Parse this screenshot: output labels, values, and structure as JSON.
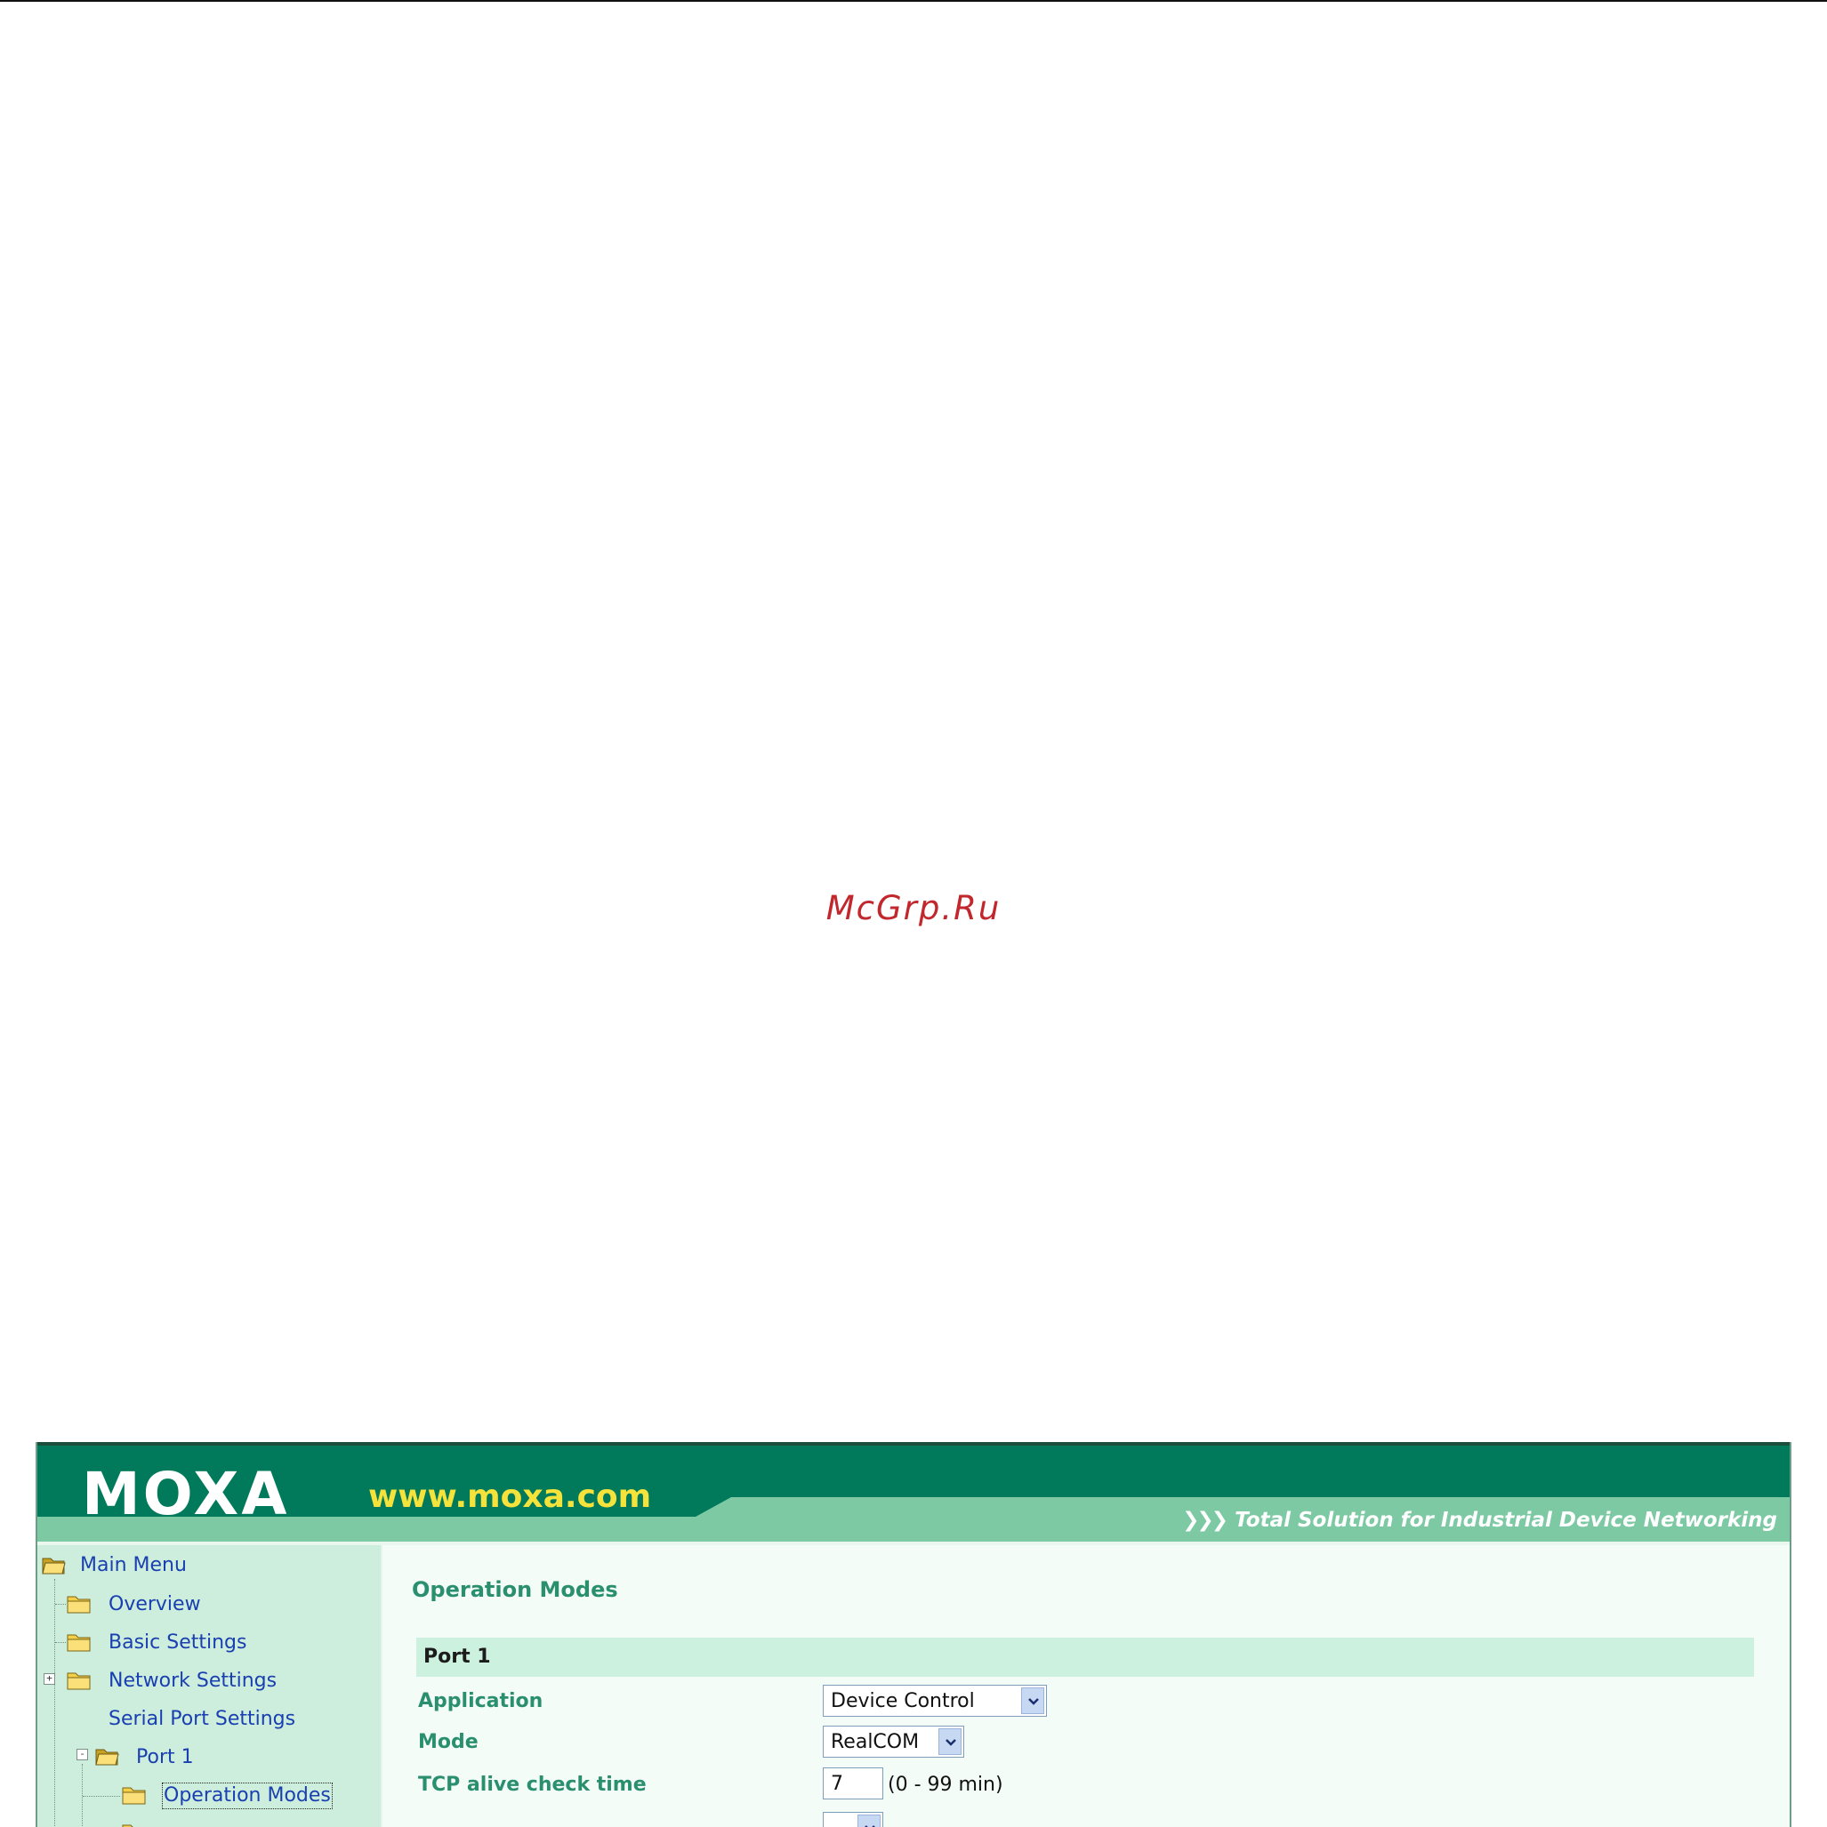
{
  "watermark": "McGrp.Ru",
  "colors": {
    "banner_green": "#007a5a",
    "banner_light_green": "#7cc9a4",
    "url_yellow": "#f5e23a",
    "nav_link_blue": "#1a3fb0",
    "label_green": "#2a8f6e",
    "sidebar_bg": "#cdeedd",
    "section_header_bg": "#cdf1df"
  },
  "banner": {
    "logo": "MOXA",
    "url": "www.moxa.com",
    "slogan_icon": "double-chevron-right-icon",
    "slogan": "Total Solution for Industrial Device Networking"
  },
  "nav": {
    "root": "Main Menu",
    "items": [
      {
        "label": "Overview",
        "icon": "folder-icon"
      },
      {
        "label": "Basic Settings",
        "icon": "folder-icon"
      },
      {
        "label": "Network Settings",
        "icon": "folder-icon",
        "expander": "+"
      },
      {
        "label": "Serial Port Settings"
      },
      {
        "label": "Port 1",
        "icon": "open-folder-icon",
        "expander": "-"
      },
      {
        "label": "Operation Modes",
        "icon": "folder-icon",
        "selected": true
      }
    ]
  },
  "main": {
    "title": "Operation Modes",
    "section": "Port 1",
    "fields": {
      "application": {
        "label": "Application",
        "value": "Device Control"
      },
      "mode": {
        "label": "Mode",
        "value": "RealCOM"
      },
      "tcp_alive": {
        "label": "TCP alive check time",
        "value": "7",
        "hint": "(0 - 99 min)"
      }
    }
  }
}
